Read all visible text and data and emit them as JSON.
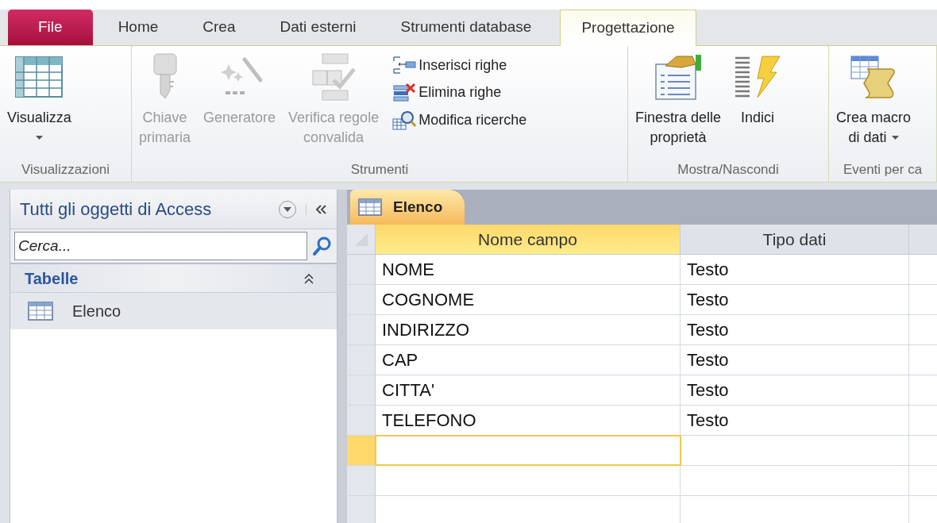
{
  "tabs": [
    {
      "label": "File",
      "kind": "file",
      "selected": false
    },
    {
      "label": "Home",
      "kind": "normal",
      "selected": false
    },
    {
      "label": "Crea",
      "kind": "normal",
      "selected": false
    },
    {
      "label": "Dati esterni",
      "kind": "normal",
      "selected": false
    },
    {
      "label": "Strumenti database",
      "kind": "normal",
      "selected": false
    },
    {
      "label": "Progettazione",
      "kind": "normal",
      "selected": true
    }
  ],
  "ribbon": {
    "groups": [
      {
        "label": "Visualizzazioni",
        "commands": [
          {
            "kind": "large",
            "label_lines": [
              "Visualizza"
            ],
            "disabled": false,
            "dropdown": true
          }
        ]
      },
      {
        "label": "Strumenti",
        "commands": [
          {
            "kind": "large",
            "label_lines": [
              "Chiave",
              "primaria"
            ],
            "disabled": true,
            "dropdown": false
          },
          {
            "kind": "large",
            "label_lines": [
              "Generatore"
            ],
            "disabled": true,
            "dropdown": false
          },
          {
            "kind": "large",
            "label_lines": [
              "Verifica regole",
              "convalida"
            ],
            "disabled": true,
            "dropdown": false
          },
          {
            "kind": "small",
            "label_lines": [
              "Inserisci righe"
            ],
            "disabled": false,
            "dropdown": false
          },
          {
            "kind": "small",
            "label_lines": [
              "Elimina righe"
            ],
            "disabled": false,
            "dropdown": false
          },
          {
            "kind": "small",
            "label_lines": [
              "Modifica ricerche"
            ],
            "disabled": false,
            "dropdown": false
          }
        ]
      },
      {
        "label": "Mostra/Nascondi",
        "commands": [
          {
            "kind": "large",
            "label_lines": [
              "Finestra delle",
              "proprietà"
            ],
            "disabled": false,
            "dropdown": false
          },
          {
            "kind": "large",
            "label_lines": [
              "Indici"
            ],
            "disabled": false,
            "dropdown": false
          }
        ]
      },
      {
        "label": "Eventi per ca",
        "commands": [
          {
            "kind": "large",
            "label_lines": [
              "Crea macro",
              "di dati"
            ],
            "disabled": false,
            "dropdown": true
          }
        ]
      }
    ]
  },
  "navigation_pane": {
    "title": "Tutti gli oggetti di Access",
    "search": {
      "placeholder": "Cerca..."
    },
    "groups": [
      {
        "label": "Tabelle",
        "expanded": true,
        "items": [
          {
            "label": "Elenco",
            "selected": true
          }
        ]
      }
    ]
  },
  "document_tabs": [
    {
      "label": "Elenco",
      "selected": true
    }
  ],
  "table": {
    "columns": [
      {
        "label": "Nome campo",
        "selected": true
      },
      {
        "label": "Tipo dati",
        "selected": false
      }
    ],
    "rows": [
      {
        "cells": [
          "NOME",
          "Testo"
        ],
        "selected": false
      },
      {
        "cells": [
          "COGNOME",
          "Testo"
        ],
        "selected": false
      },
      {
        "cells": [
          "INDIRIZZO",
          "Testo"
        ],
        "selected": false
      },
      {
        "cells": [
          "CAP",
          "Testo"
        ],
        "selected": false
      },
      {
        "cells": [
          "CITTA'",
          "Testo"
        ],
        "selected": false
      },
      {
        "cells": [
          "TELEFONO",
          "Testo"
        ],
        "selected": false
      }
    ],
    "new_row": {
      "selected": true
    }
  }
}
